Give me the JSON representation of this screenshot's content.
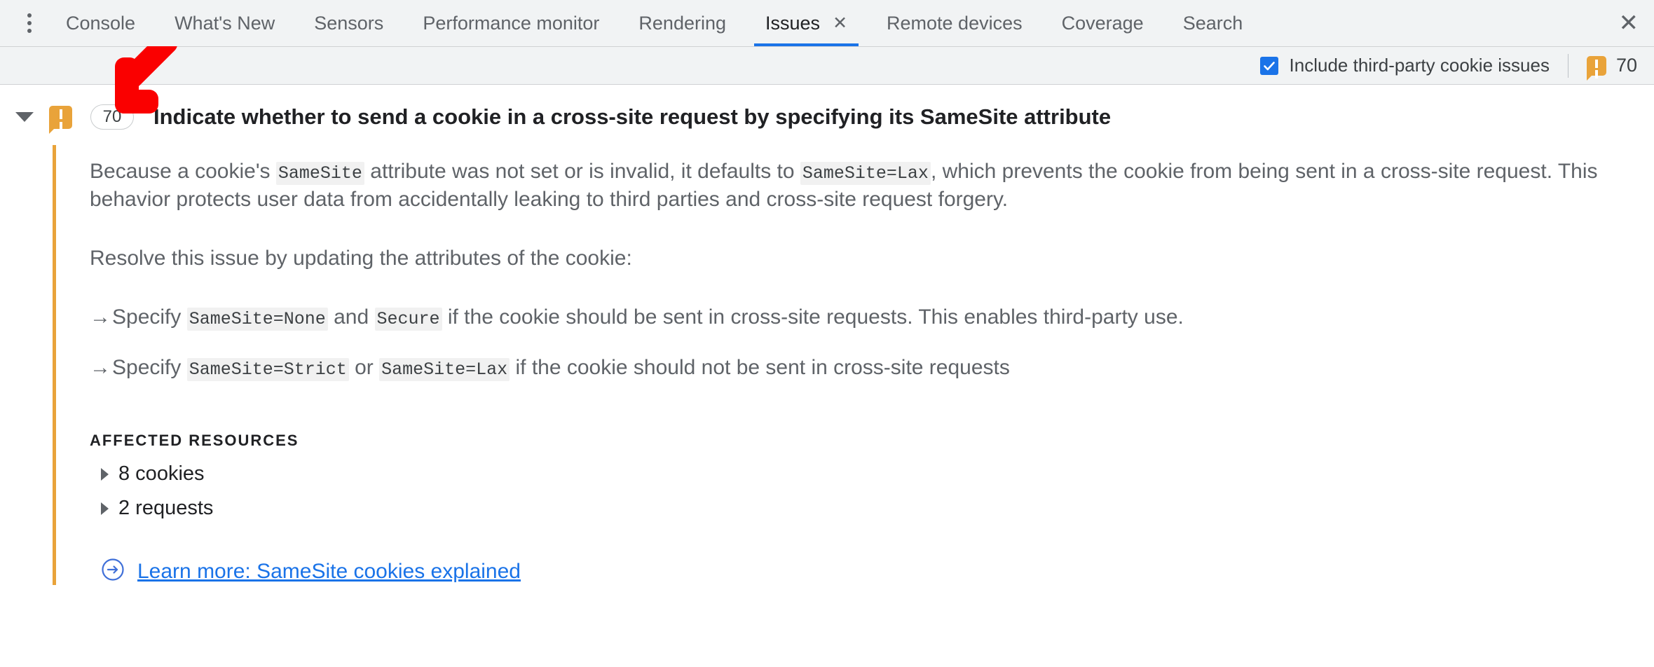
{
  "tabbar": {
    "more_label": "more-tabs",
    "tabs": [
      {
        "label": "Console",
        "active": false
      },
      {
        "label": "What's New",
        "active": false
      },
      {
        "label": "Sensors",
        "active": false
      },
      {
        "label": "Performance monitor",
        "active": false
      },
      {
        "label": "Rendering",
        "active": false
      },
      {
        "label": "Issues",
        "active": true
      },
      {
        "label": "Remote devices",
        "active": false
      },
      {
        "label": "Coverage",
        "active": false
      },
      {
        "label": "Search",
        "active": false
      }
    ],
    "tab_close_glyph": "✕",
    "panel_close_glyph": "✕"
  },
  "filterbar": {
    "checkbox_label": "Include third-party cookie issues",
    "checkbox_checked": true,
    "warning_count": "70"
  },
  "issue": {
    "count_badge": "70",
    "title": "Indicate whether to send a cookie in a cross-site request by specifying its SameSite attribute",
    "paragraph1_a": "Because a cookie's ",
    "paragraph1_code1": "SameSite",
    "paragraph1_b": " attribute was not set or is invalid, it defaults to ",
    "paragraph1_code2": "SameSite=Lax",
    "paragraph1_c": ", which prevents the cookie from being sent in a cross-site request. This behavior protects user data from accidentally leaking to third parties and cross-site request forgery.",
    "paragraph2": "Resolve this issue by updating the attributes of the cookie:",
    "arrow_mark": "→",
    "bullet1_a": "Specify ",
    "bullet1_code1": "SameSite=None",
    "bullet1_b": " and ",
    "bullet1_code2": "Secure",
    "bullet1_c": " if the cookie should be sent in cross-site requests. This enables third-party use.",
    "bullet2_a": "Specify ",
    "bullet2_code1": "SameSite=Strict",
    "bullet2_b": " or ",
    "bullet2_code2": "SameSite=Lax",
    "bullet2_c": " if the cookie should not be sent in cross-site requests",
    "affected_resources_label": "AFFECTED RESOURCES",
    "resources": [
      {
        "label": "8 cookies"
      },
      {
        "label": "2 requests"
      }
    ],
    "learn_more_label": "Learn more: SameSite cookies explained"
  },
  "annotation": {
    "arrow_color": "#fa0000",
    "arrow_direction": "down-left"
  },
  "colors": {
    "accent": "#1a73e8",
    "warning": "#e9a33a",
    "toolbar_bg": "#f1f3f4",
    "text": "#5f6368"
  }
}
